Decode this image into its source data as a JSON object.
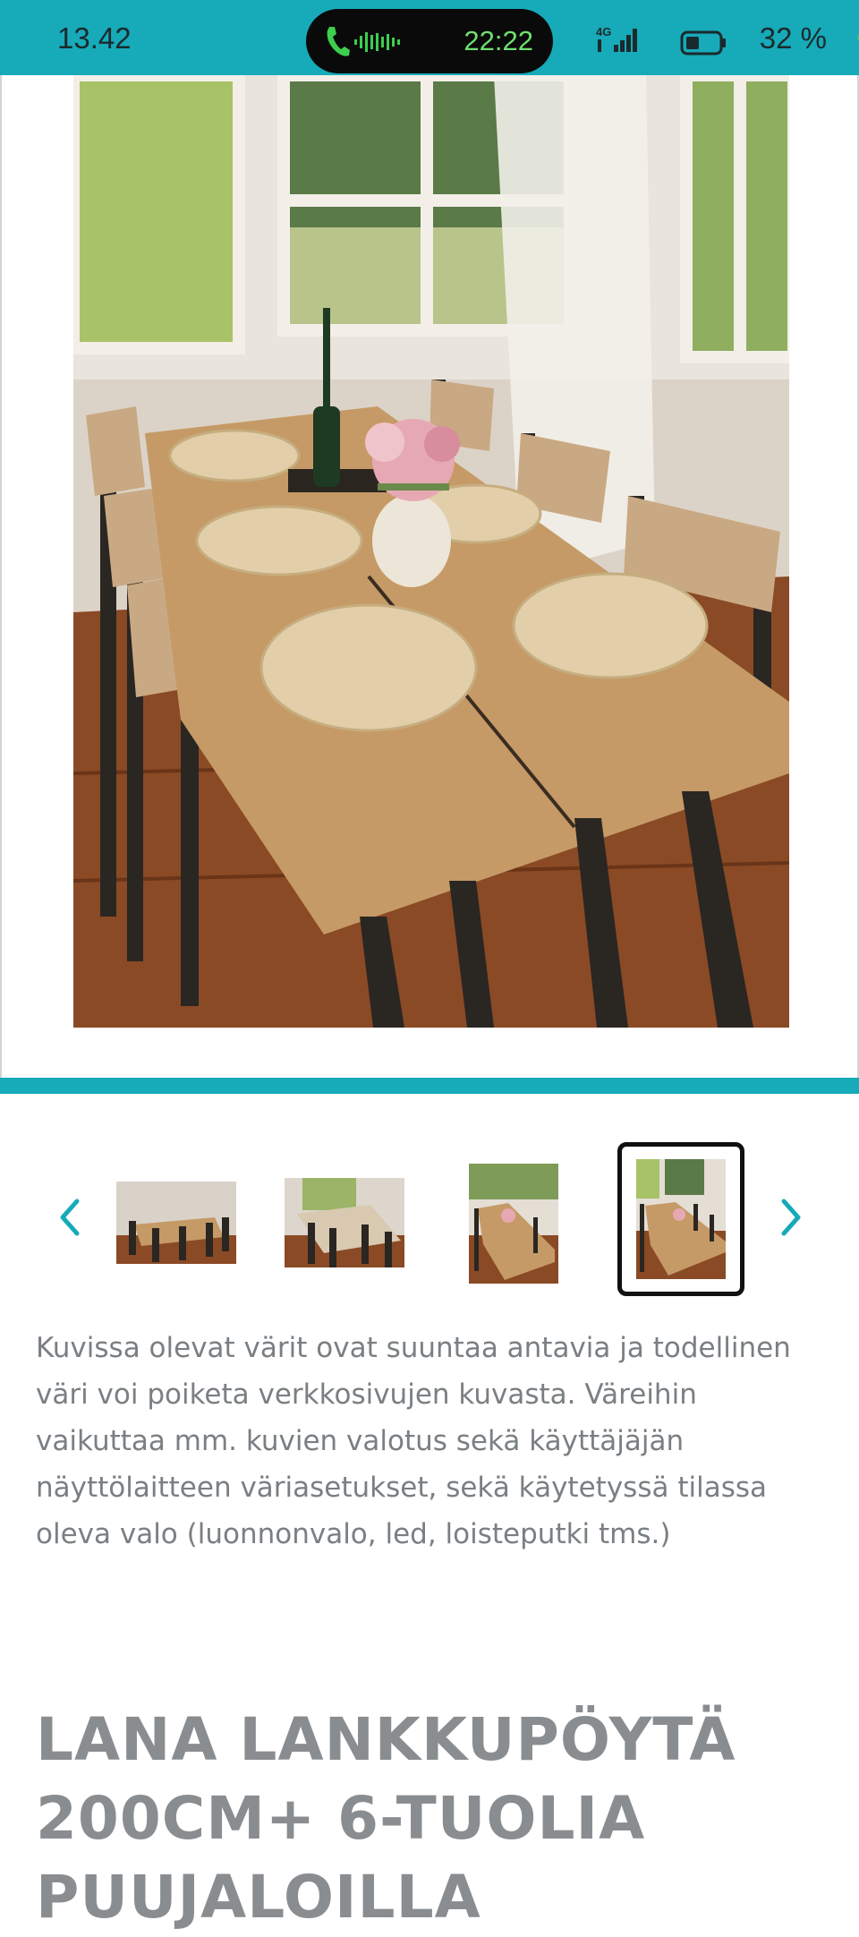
{
  "status_bar": {
    "time": "13.42",
    "call_duration": "22:22",
    "network": "4G",
    "battery": "32 %"
  },
  "gallery": {
    "main_image_alt": "Dining table with six chairs by a window",
    "thumbnail_count": 4,
    "selected_index": 3
  },
  "product": {
    "disclaimer": "Kuvissa olevat värit ovat suuntaa antavia ja todellinen väri voi poiketa verkkosivujen kuvasta. Väreihin vaikuttaa mm. kuvien valotus sekä käyttäjäjän näyttölaitteen väriasetukset, sekä käytetyssä tilassa oleva valo (luonnonvalo, led, loisteputki tms.)",
    "title": "LANA LANKKUPÖYTÄ 200CM+ 6-TUOLIA PUUJALOILLA"
  },
  "colors": {
    "accent": "#17aab9",
    "text_muted": "#7a7f83"
  },
  "icons": [
    "phone-icon",
    "audio-wave-icon",
    "signal-icon",
    "battery-icon",
    "chevron-left-icon",
    "chevron-right-icon"
  ]
}
